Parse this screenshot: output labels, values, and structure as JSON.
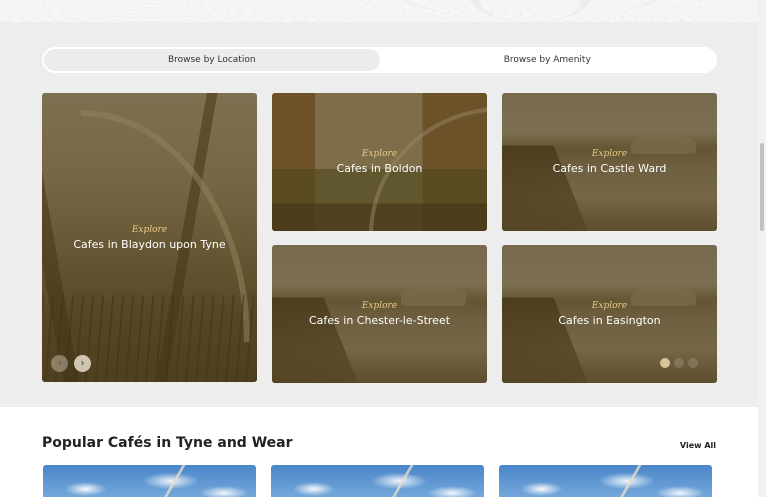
{
  "tabs": [
    {
      "label": "Browse by Location",
      "active": true
    },
    {
      "label": "Browse by Amenity",
      "active": false
    }
  ],
  "cards": [
    {
      "explore": "Explore",
      "title": "Cafes in Blaydon upon Tyne",
      "image": "bridge"
    },
    {
      "explore": "Explore",
      "title": "Cafes in Boldon",
      "image": "boldon"
    },
    {
      "explore": "Explore",
      "title": "Cafes in Castle Ward",
      "image": "river"
    },
    {
      "explore": "Explore",
      "title": "Cafes in Chester-le-Street",
      "image": "river"
    },
    {
      "explore": "Explore",
      "title": "Cafes in Easington",
      "image": "river"
    }
  ],
  "carousel": {
    "prev_icon": "‹",
    "next_icon": "›",
    "dots": 3,
    "active_dot": 0
  },
  "popular": {
    "title": "Popular Cafés in Tyne and Wear",
    "view_all": "View All"
  },
  "colors": {
    "tint": "#604a1a",
    "explore_text": "#e7c989",
    "section_bg": "#ededed"
  }
}
